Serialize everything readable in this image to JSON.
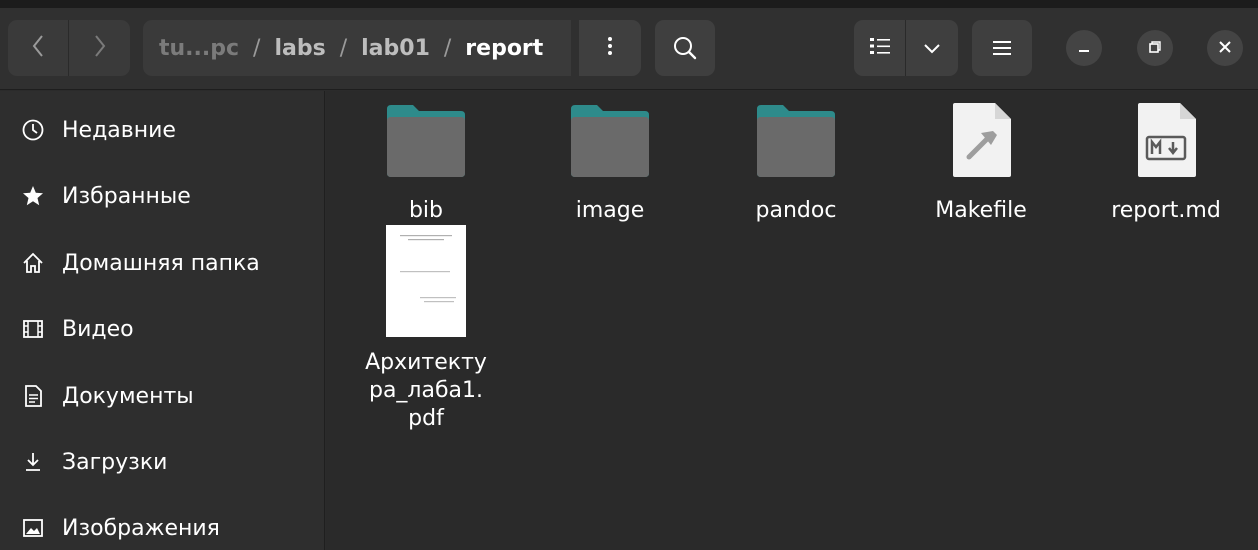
{
  "header": {
    "path_prefix": "tu...pc",
    "path_segments": [
      "labs",
      "lab01"
    ],
    "path_separator": "/",
    "current_folder": "report",
    "icons": {
      "back": "chevron-left-icon",
      "forward": "chevron-right-icon",
      "path_menu": "kebab-menu-icon",
      "search": "search-icon",
      "view_list": "list-view-icon",
      "view_options": "chevron-down-icon",
      "main_menu": "hamburger-menu-icon",
      "minimize": "minimize-icon",
      "maximize": "restore-icon",
      "close": "close-icon"
    }
  },
  "sidebar": {
    "items": [
      {
        "label": "Недавние",
        "icon": "clock-icon"
      },
      {
        "label": "Избранные",
        "icon": "star-icon"
      },
      {
        "label": "Домашняя папка",
        "icon": "home-icon"
      },
      {
        "label": "Видео",
        "icon": "film-icon"
      },
      {
        "label": "Документы",
        "icon": "document-icon"
      },
      {
        "label": "Загрузки",
        "icon": "download-icon"
      },
      {
        "label": "Изображения",
        "icon": "image-icon"
      }
    ]
  },
  "files": [
    {
      "name": "bib",
      "type": "folder"
    },
    {
      "name": "image",
      "type": "folder"
    },
    {
      "name": "pandoc",
      "type": "folder"
    },
    {
      "name": "Makefile",
      "type": "makefile"
    },
    {
      "name": "report.md",
      "type": "markdown"
    },
    {
      "name_lines": [
        "Архитекту",
        "ра_лаба1.",
        "pdf"
      ],
      "type": "pdf"
    }
  ],
  "colors": {
    "folder_tab": "#2e8b8b",
    "folder_body": "#6a6a6a",
    "window_bg": "#2a2a2a",
    "headerbar_bg": "#303030"
  }
}
